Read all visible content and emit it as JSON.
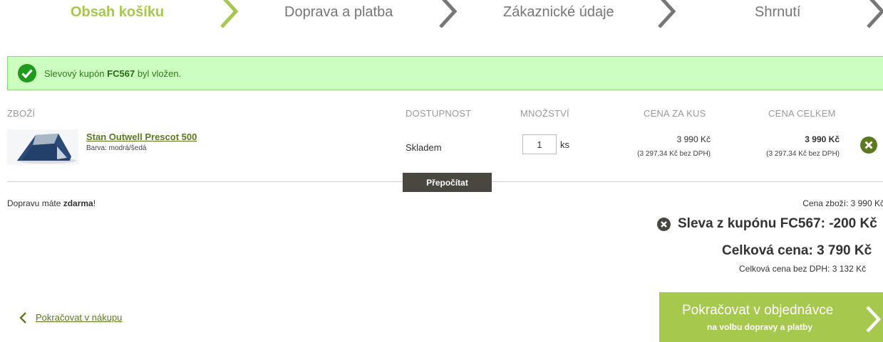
{
  "steps": [
    {
      "label": "Obsah košíku",
      "active": true
    },
    {
      "label": "Doprava a platba",
      "active": false
    },
    {
      "label": "Zákaznické údaje",
      "active": false
    },
    {
      "label": "Shrnutí",
      "active": false
    }
  ],
  "alert": {
    "prefix": "Slevový kupón ",
    "code": "FC567",
    "suffix": " byl vložen."
  },
  "table": {
    "headers": {
      "item": "ZBOŽÍ",
      "availability": "DOSTUPNOST",
      "quantity": "MNOŽSTVÍ",
      "unit_price": "CENA ZA KUS",
      "total_price": "CENA CELKEM"
    },
    "row": {
      "name": "Stan Outwell Prescot 500",
      "variant": "Barva: modrá/šedá",
      "availability": "Skladem",
      "quantity": "1",
      "unit": "ks",
      "unit_price": "3 990 Kč",
      "unit_price_nodph": "(3 297,34 Kč bez DPH)",
      "total_price": "3 990 Kč",
      "total_price_nodph": "(3 297,34 Kč bez DPH)"
    }
  },
  "recalc_label": "Přepočítat",
  "shipping": {
    "prefix": "Dopravu máte ",
    "bold": "zdarma",
    "suffix": "!"
  },
  "summary": {
    "goods": "Cena zboží: 3 990 Kč",
    "discount": "Sleva z kupónu FC567: -200 Kč",
    "total": "Celková cena: 3 790 Kč",
    "total_nodph": "Celková cena bez DPH: 3 132 Kč"
  },
  "back_link": "Pokračovat v nákupu",
  "continue": {
    "main": "Pokračovat v objednávce",
    "sub": "na volbu dopravy a platby"
  },
  "colors": {
    "accent": "#a6c94d",
    "alert_bg": "#ccffbf",
    "link": "#5b7a1e",
    "dark_button": "#4a4640",
    "remove": "#5b7a1e"
  }
}
